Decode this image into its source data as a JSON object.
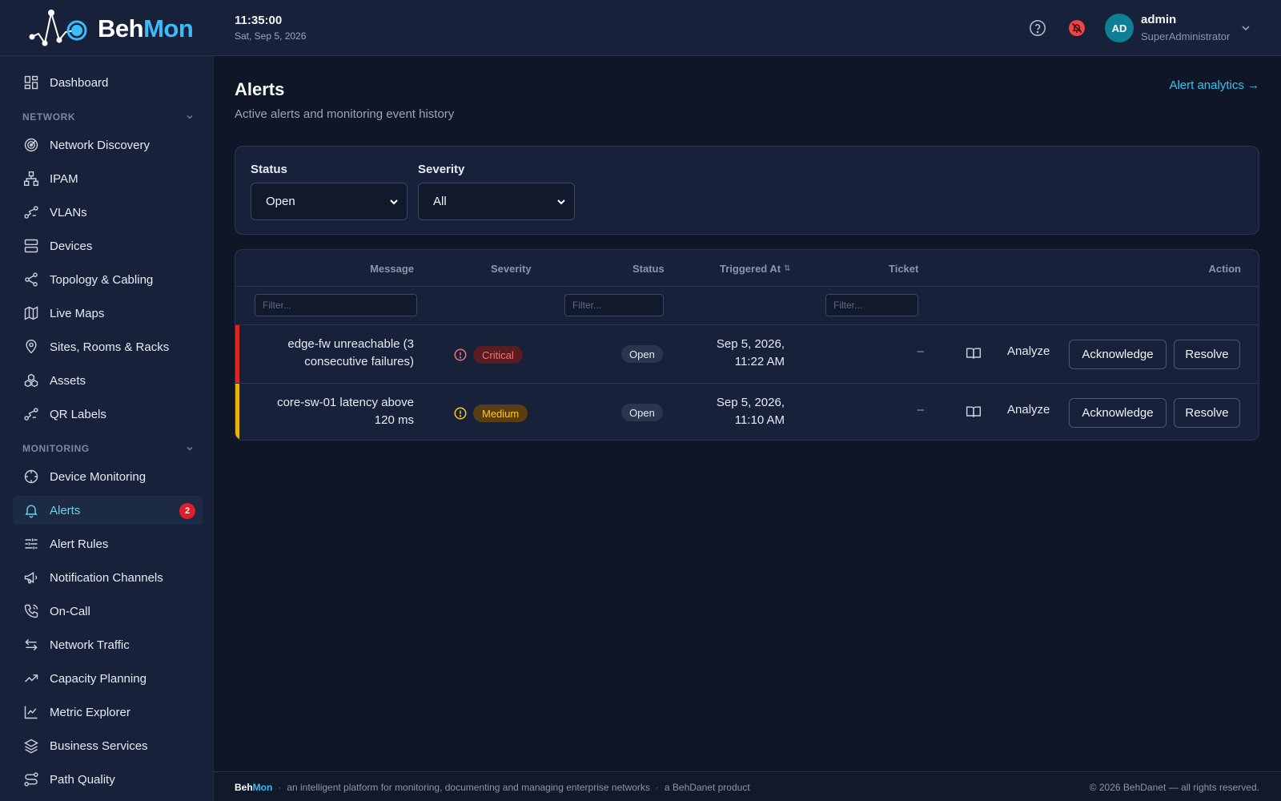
{
  "brand": {
    "part1": "Beh",
    "part2": "Mon",
    "accent": "#38bdf8"
  },
  "header": {
    "time": "11:35:00",
    "date": "Sat, Sep 5, 2026",
    "help_icon": "help-circle-icon",
    "notifications_icon": "bell-off-icon",
    "user": {
      "initials": "AD",
      "name": "admin",
      "role": "SuperAdministrator"
    }
  },
  "sidebar": {
    "top": [
      {
        "label": "Dashboard",
        "icon": "dashboard-icon"
      }
    ],
    "sections": [
      {
        "title": "NETWORK",
        "items": [
          {
            "label": "Network Discovery",
            "icon": "radar-icon"
          },
          {
            "label": "IPAM",
            "icon": "network-tree-icon"
          },
          {
            "label": "VLANs",
            "icon": "route-icon"
          },
          {
            "label": "Devices",
            "icon": "server-icon"
          },
          {
            "label": "Topology & Cabling",
            "icon": "share-icon"
          },
          {
            "label": "Live Maps",
            "icon": "map-icon"
          },
          {
            "label": "Sites, Rooms & Racks",
            "icon": "location-pin-icon"
          },
          {
            "label": "Assets",
            "icon": "boxes-icon"
          },
          {
            "label": "QR Labels",
            "icon": "qr-route-icon"
          }
        ]
      },
      {
        "title": "MONITORING",
        "items": [
          {
            "label": "Device Monitoring",
            "icon": "crosshair-icon"
          },
          {
            "label": "Alerts",
            "icon": "bell-icon",
            "badge": "2",
            "active": true
          },
          {
            "label": "Alert Rules",
            "icon": "sliders-icon"
          },
          {
            "label": "Notification Channels",
            "icon": "megaphone-icon"
          },
          {
            "label": "On-Call",
            "icon": "phone-icon"
          },
          {
            "label": "Network Traffic",
            "icon": "arrows-icon"
          },
          {
            "label": "Capacity Planning",
            "icon": "trending-up-icon"
          },
          {
            "label": "Metric Explorer",
            "icon": "line-chart-icon"
          },
          {
            "label": "Business Services",
            "icon": "layers-icon"
          },
          {
            "label": "Path Quality",
            "icon": "path-icon"
          }
        ]
      }
    ]
  },
  "page": {
    "title": "Alerts",
    "subtitle": "Active alerts and monitoring event history",
    "analytics_link": "Alert analytics →"
  },
  "filters": {
    "status": {
      "label": "Status",
      "value": "Open"
    },
    "severity": {
      "label": "Severity",
      "value": "All"
    }
  },
  "table": {
    "columns": [
      "Message",
      "Severity",
      "Status",
      "Triggered At",
      "Ticket",
      "Action"
    ],
    "sort_icon": "⇅",
    "filter_placeholder": "Filter...",
    "rows": [
      {
        "message_1": "edge-fw unreachable (3",
        "message_2": "consecutive failures)",
        "severity": "Critical",
        "severity_color": "#e11d2a",
        "status": "Open",
        "triggered_1": "Sep 5, 2026,",
        "triggered_2": "11:22 AM",
        "ticket": "–"
      },
      {
        "message_1": "core-sw-01 latency above",
        "message_2": "120 ms",
        "severity": "Medium",
        "severity_color": "#eab308",
        "status": "Open",
        "triggered_1": "Sep 5, 2026,",
        "triggered_2": "11:10 AM",
        "ticket": "–"
      }
    ],
    "actions": {
      "analyze": "Analyze",
      "acknowledge": "Acknowledge",
      "resolve": "Resolve"
    }
  },
  "footer": {
    "brand_1": "Beh",
    "brand_2": "Mon",
    "tagline": "an intelligent platform for monitoring, documenting and managing enterprise networks",
    "product": "a BehDanet product",
    "copyright": "© 2026 BehDanet — all rights reserved."
  }
}
